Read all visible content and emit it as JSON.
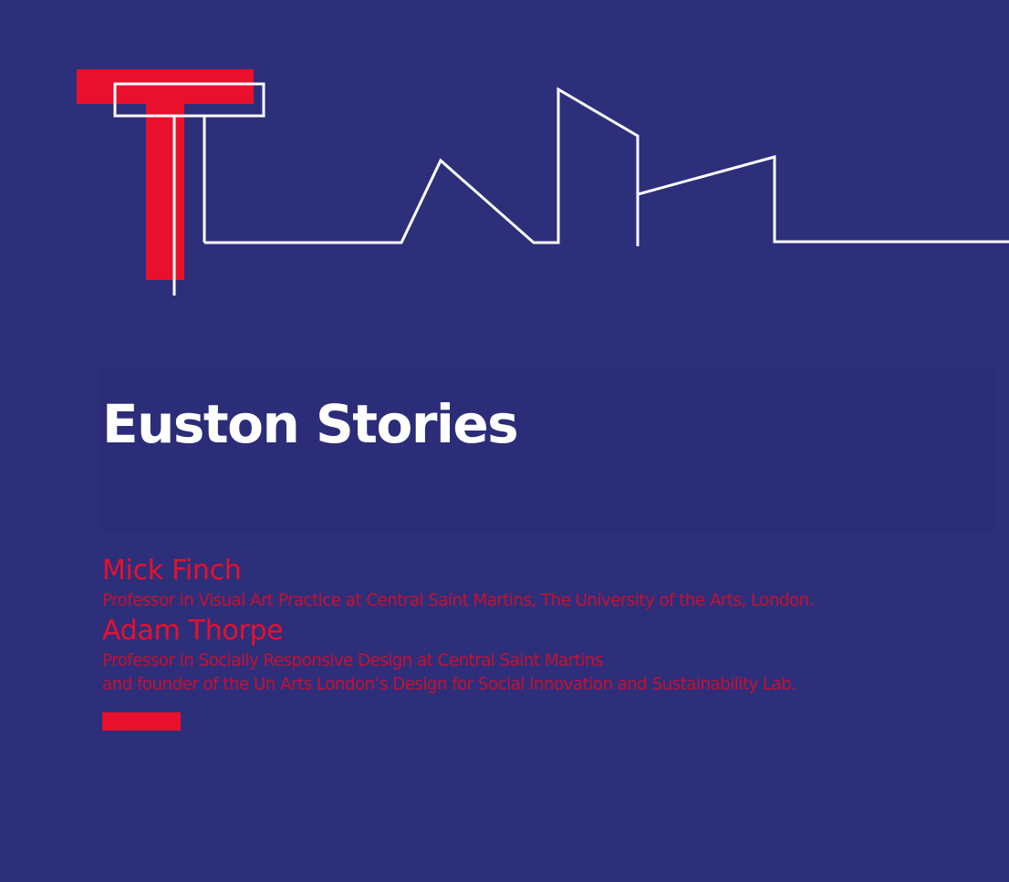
{
  "title": "Euston Stories",
  "colors": {
    "background": "#2d2f7b",
    "accent_red": "#e8102c",
    "outline_white": "#ffffff"
  },
  "people": [
    {
      "name": "Mick Finch",
      "role_lines": [
        "Professor in Visual Art Practice at Central Saint Martins, The University of the Arts, London."
      ]
    },
    {
      "name": "Adam Thorpe",
      "role_lines": [
        "Professor in Socially Responsive Design at Central Saint Martins",
        "and founder of the Un Arts London’s Design for Social Innovation and Sustainability Lab."
      ]
    }
  ]
}
